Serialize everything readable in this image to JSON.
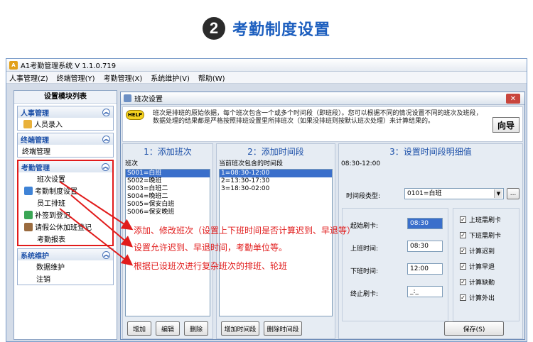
{
  "heading": {
    "number": "2",
    "text": "考勤制度设置"
  },
  "app": {
    "title": "A1考勤管理系统 V 1.1.0.719",
    "menu": [
      "人事管理(Z)",
      "终端管理(Y)",
      "考勤管理(X)",
      "系统维护(V)",
      "帮助(W)"
    ]
  },
  "sidebar": {
    "title": "设置模块列表",
    "groups": [
      {
        "head": "人事管理",
        "items": [
          "人员录入"
        ]
      },
      {
        "head": "终端管理",
        "items": [
          "终端管理"
        ]
      },
      {
        "head": "考勤管理",
        "items": [
          "班次设置",
          "考勤制度设置",
          "员工排班",
          "补签到登记",
          "请假公休加班登记",
          "考勤报表"
        ]
      },
      {
        "head": "系统维护",
        "items": [
          "数据维护",
          "注销"
        ]
      }
    ]
  },
  "dialog": {
    "title": "班次设置",
    "help_label": "HELP",
    "info": "班次是排班的原始依据，每个班次包含一个或多个时间段（即班段）。您可以根据不同的情况设置不同的班次及班段，数据处理的结果都是严格按照排班设置里所排班次（如果没排班则按默认班次处理）来计算结果的。",
    "guide_button": "向导",
    "panel1": {
      "title": "1：添加班次",
      "list_label": "班次",
      "shifts": [
        "S001=白班",
        "S002=晚班",
        "S003=白班二",
        "S004=晚班二",
        "S005=保安白班",
        "S006=保安晚班"
      ],
      "buttons": [
        "增加",
        "编辑",
        "删除"
      ]
    },
    "panel2": {
      "title": "2：添加时间段",
      "list_label": "当前班次包含的时间段",
      "periods": [
        "1=08:30-12:00",
        "2=13:30-17:30",
        "3=18:30-02:00"
      ],
      "buttons": [
        "增加时间段",
        "删除时间段"
      ]
    },
    "panel3": {
      "title": "3：设置时间段明细值",
      "range": "08:30-12:00",
      "type_label": "时间段类型:",
      "type_value": "0101=白班",
      "browse": "...",
      "start_card_label": "起始刷卡:",
      "start_card_value": "08:30",
      "on_duty_label": "上班时间:",
      "on_duty_value": "08:30",
      "off_duty_label": "下班时间:",
      "off_duty_value": "12:00",
      "end_card_label": "终止刷卡:",
      "end_card_value": "_:_",
      "checks": [
        "上班需刷卡",
        "下班需刷卡",
        "计算迟到",
        "计算早退",
        "计算缺勤",
        "计算外出"
      ],
      "save": "保存(S)"
    }
  },
  "annotations": [
    "添加、修改班次（设置上下班时间是否计算迟到、早退等）",
    "设置允许迟到、早退时间，考勤单位等。",
    "根据已设班次进行复杂班次的排班、轮班"
  ],
  "colors": {
    "accent": "#1b4fa8",
    "annotation": "#e11b1b",
    "heading": "#1d5fbf"
  }
}
